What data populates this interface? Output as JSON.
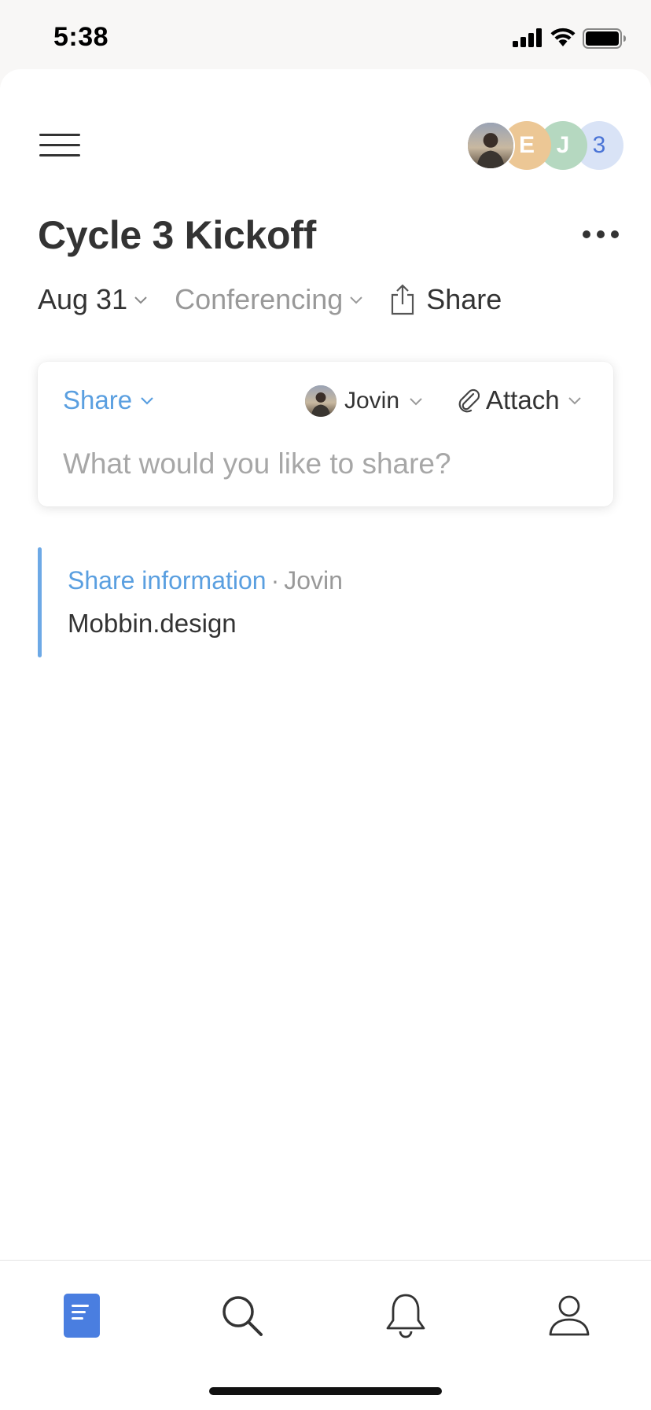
{
  "status_bar": {
    "time": "5:38"
  },
  "header": {
    "title": "Cycle 3 Kickoff",
    "participants": [
      {
        "type": "photo"
      },
      {
        "initial": "E",
        "color": "#ecc795"
      },
      {
        "initial": "J",
        "color": "#b5d8c0"
      }
    ],
    "more_count": "3"
  },
  "meta": {
    "date": "Aug 31",
    "category": "Conferencing",
    "share_label": "Share"
  },
  "composer": {
    "type_label": "Share",
    "user_label": "Jovin",
    "attach_label": "Attach",
    "placeholder": "What would you like to share?",
    "value": ""
  },
  "posts": [
    {
      "type": "Share information",
      "separator": "·",
      "author": "Jovin",
      "body": "Mobbin.design"
    }
  ],
  "colors": {
    "accent": "#5a9fe0",
    "active_tab": "#4a7ee0"
  },
  "tabs": [
    {
      "icon": "document-icon",
      "active": true
    },
    {
      "icon": "search-icon",
      "active": false
    },
    {
      "icon": "bell-icon",
      "active": false
    },
    {
      "icon": "profile-icon",
      "active": false
    }
  ]
}
